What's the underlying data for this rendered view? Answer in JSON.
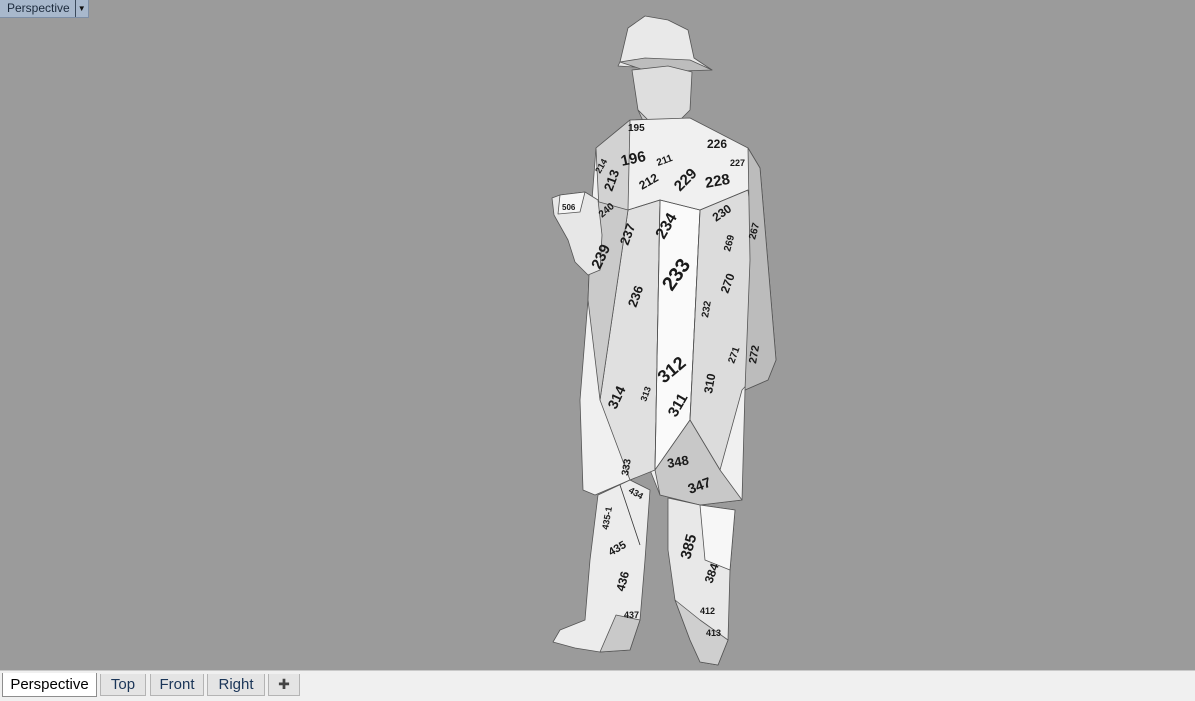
{
  "viewport": {
    "title": "Perspective",
    "menu_icon": "dropdown-arrow-icon"
  },
  "model": {
    "labels": [
      {
        "text": "195"
      },
      {
        "text": "196"
      },
      {
        "text": "214"
      },
      {
        "text": "213"
      },
      {
        "text": "212"
      },
      {
        "text": "211"
      },
      {
        "text": "226"
      },
      {
        "text": "227"
      },
      {
        "text": "229"
      },
      {
        "text": "228"
      },
      {
        "text": "230"
      },
      {
        "text": "234"
      },
      {
        "text": "237"
      },
      {
        "text": "239"
      },
      {
        "text": "240"
      },
      {
        "text": "236"
      },
      {
        "text": "233"
      },
      {
        "text": "269"
      },
      {
        "text": "267"
      },
      {
        "text": "270"
      },
      {
        "text": "232"
      },
      {
        "text": "271"
      },
      {
        "text": "272"
      },
      {
        "text": "312"
      },
      {
        "text": "314"
      },
      {
        "text": "313"
      },
      {
        "text": "311"
      },
      {
        "text": "310"
      },
      {
        "text": "348"
      },
      {
        "text": "347"
      },
      {
        "text": "333"
      },
      {
        "text": "434"
      },
      {
        "text": "435"
      },
      {
        "text": "385"
      },
      {
        "text": "384"
      },
      {
        "text": "436"
      },
      {
        "text": "412"
      },
      {
        "text": "413"
      },
      {
        "text": "437"
      },
      {
        "text": "506"
      },
      {
        "text": "435-1"
      }
    ]
  },
  "tabs": [
    {
      "label": "Perspective",
      "active": true
    },
    {
      "label": "Top",
      "active": false
    },
    {
      "label": "Front",
      "active": false
    },
    {
      "label": "Right",
      "active": false
    }
  ],
  "add_tab_icon": "plus-icon",
  "colors": {
    "viewport_background": "#9b9b9b",
    "tabbar_background": "#f0f0f0",
    "title_background": "#a8b8cc"
  }
}
